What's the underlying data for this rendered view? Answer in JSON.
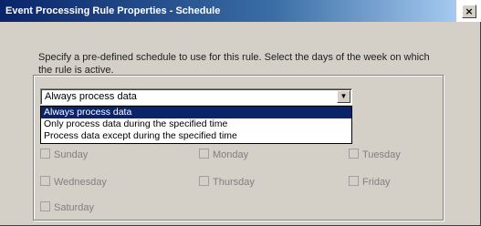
{
  "window": {
    "title": "Event Processing Rule Properties - Schedule",
    "close_glyph": "×"
  },
  "description": "Specify a pre-defined schedule to use for this rule. Select the days of the week on which the rule is active.",
  "schedule": {
    "selected": "Always process data",
    "options": [
      "Always process data",
      "Only process data during the specified time",
      "Process data except during the specified time"
    ]
  },
  "days": {
    "sunday": "Sunday",
    "monday": "Monday",
    "tuesday": "Tuesday",
    "wednesday": "Wednesday",
    "thursday": "Thursday",
    "friday": "Friday",
    "saturday": "Saturday"
  },
  "icons": {
    "dropdown_arrow": "chevron-down-icon"
  },
  "colors": {
    "titlebar_start": "#0a246a",
    "titlebar_end": "#a6caf0",
    "selection": "#0a246a",
    "face": "#d4d0c8"
  }
}
